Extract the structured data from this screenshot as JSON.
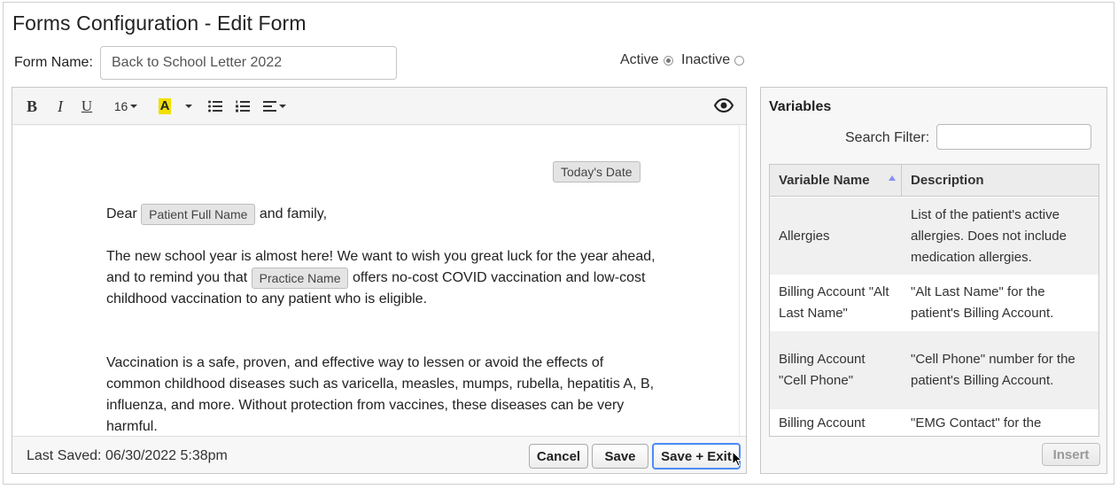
{
  "page": {
    "title": "Forms Configuration - Edit Form"
  },
  "form": {
    "name_label": "Form Name:",
    "name_value": "Back to School Letter 2022",
    "status": {
      "active_label": "Active",
      "inactive_label": "Inactive",
      "selected": "Active"
    }
  },
  "toolbar": {
    "bold_label": "B",
    "italic_label": "I",
    "underline_label": "U",
    "font_size": "16",
    "highlight_label": "A",
    "icons": [
      "bold-icon",
      "italic-icon",
      "underline-icon",
      "font-size-dropdown",
      "highlight-color-icon",
      "bullet-list-icon",
      "numbered-list-icon",
      "align-icon",
      "preview-eye-icon"
    ]
  },
  "document": {
    "date_chip": "Today's Date",
    "dear_prefix": "Dear",
    "patient_chip": "Patient Full Name",
    "dear_suffix": "and family,",
    "p1_part1": "The new school year is almost here! We want to wish you great luck for the year ahead, and to remind you that",
    "practice_chip": "Practice Name",
    "p1_part2": "offers no-cost COVID vaccination and low-cost childhood vaccination to any patient who is eligible.",
    "p2": "Vaccination is a safe, proven, and effective way to lessen or avoid the effects of common childhood diseases such as varicella, measles, mumps, rubella, hepatitis A, B, influenza, and more. Without protection from vaccines, these diseases can be very harmful."
  },
  "footer": {
    "last_saved": "Last Saved: 06/30/2022 5:38pm",
    "cancel_label": "Cancel",
    "save_label": "Save",
    "save_exit_label": "Save + Exit"
  },
  "variables": {
    "title": "Variables",
    "filter_label": "Search Filter:",
    "filter_value": "",
    "columns": [
      "Variable Name",
      "Description"
    ],
    "rows": [
      {
        "name": "Allergies",
        "description": "List of the patient's active allergies. Does not include medication allergies."
      },
      {
        "name": "Billing Account \"Alt Last Name\"",
        "description": "\"Alt Last Name\" for the patient's Billing Account."
      },
      {
        "name": "Billing Account \"Cell Phone\"",
        "description": "\"Cell Phone\" number for the patient's Billing Account."
      },
      {
        "name": "Billing Account",
        "description": "\"EMG Contact\" for the"
      }
    ],
    "insert_label": "Insert"
  },
  "colors": {
    "focus_ring": "#4c8bf5",
    "highlight": "#f0e000",
    "sort_arrow": "#8a8ef0"
  }
}
